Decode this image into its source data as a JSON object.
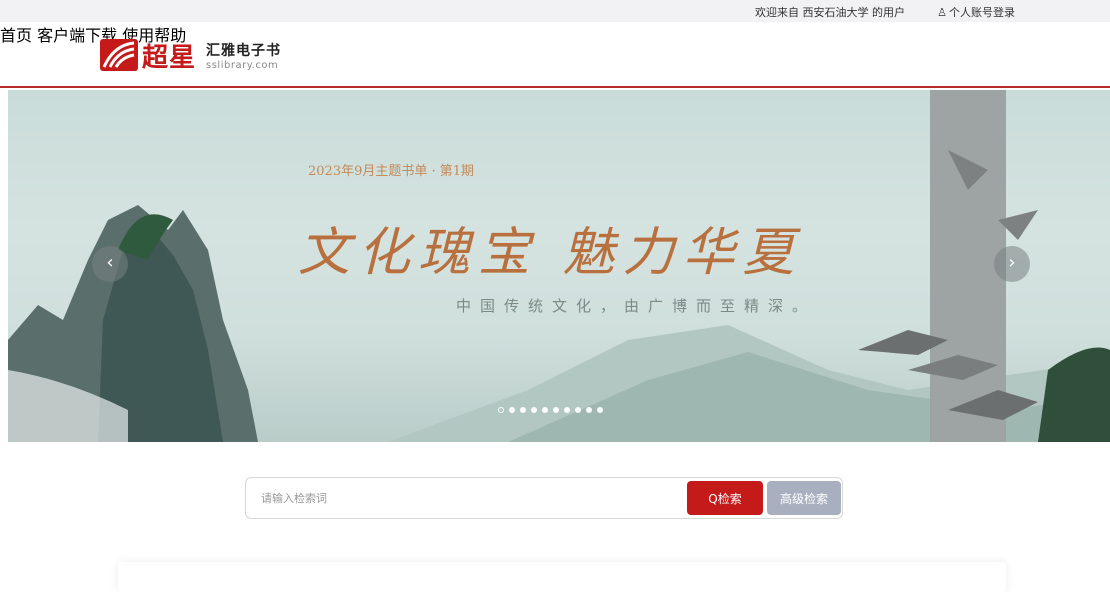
{
  "topbar": {
    "welcome": "欢迎来自 西安石油大学 的用户",
    "login_icon": "user-icon",
    "login_label": "个人账号登录"
  },
  "header": {
    "logo_text": "超星",
    "brand_name": "汇雅电子书",
    "brand_url": "sslibrary.com",
    "accent_color": "#b52a2a"
  },
  "nav": {
    "items": [
      {
        "label": "首页"
      },
      {
        "label": "客户端下载"
      },
      {
        "label": "使用帮助"
      }
    ]
  },
  "banner": {
    "issue": "2023年9月主题书单 · 第1期",
    "headline": "文化瑰宝 魅力华夏",
    "subline": "中国传统文化，由广博而至精深。",
    "prev_icon": "chevron-left-icon",
    "next_icon": "chevron-right-icon",
    "slide_count": 10,
    "active_slide": 1
  },
  "search": {
    "placeholder": "请输入检索词",
    "search_label": "Q检索",
    "advanced_label": "高级检索",
    "search_color": "#c41a1a"
  }
}
